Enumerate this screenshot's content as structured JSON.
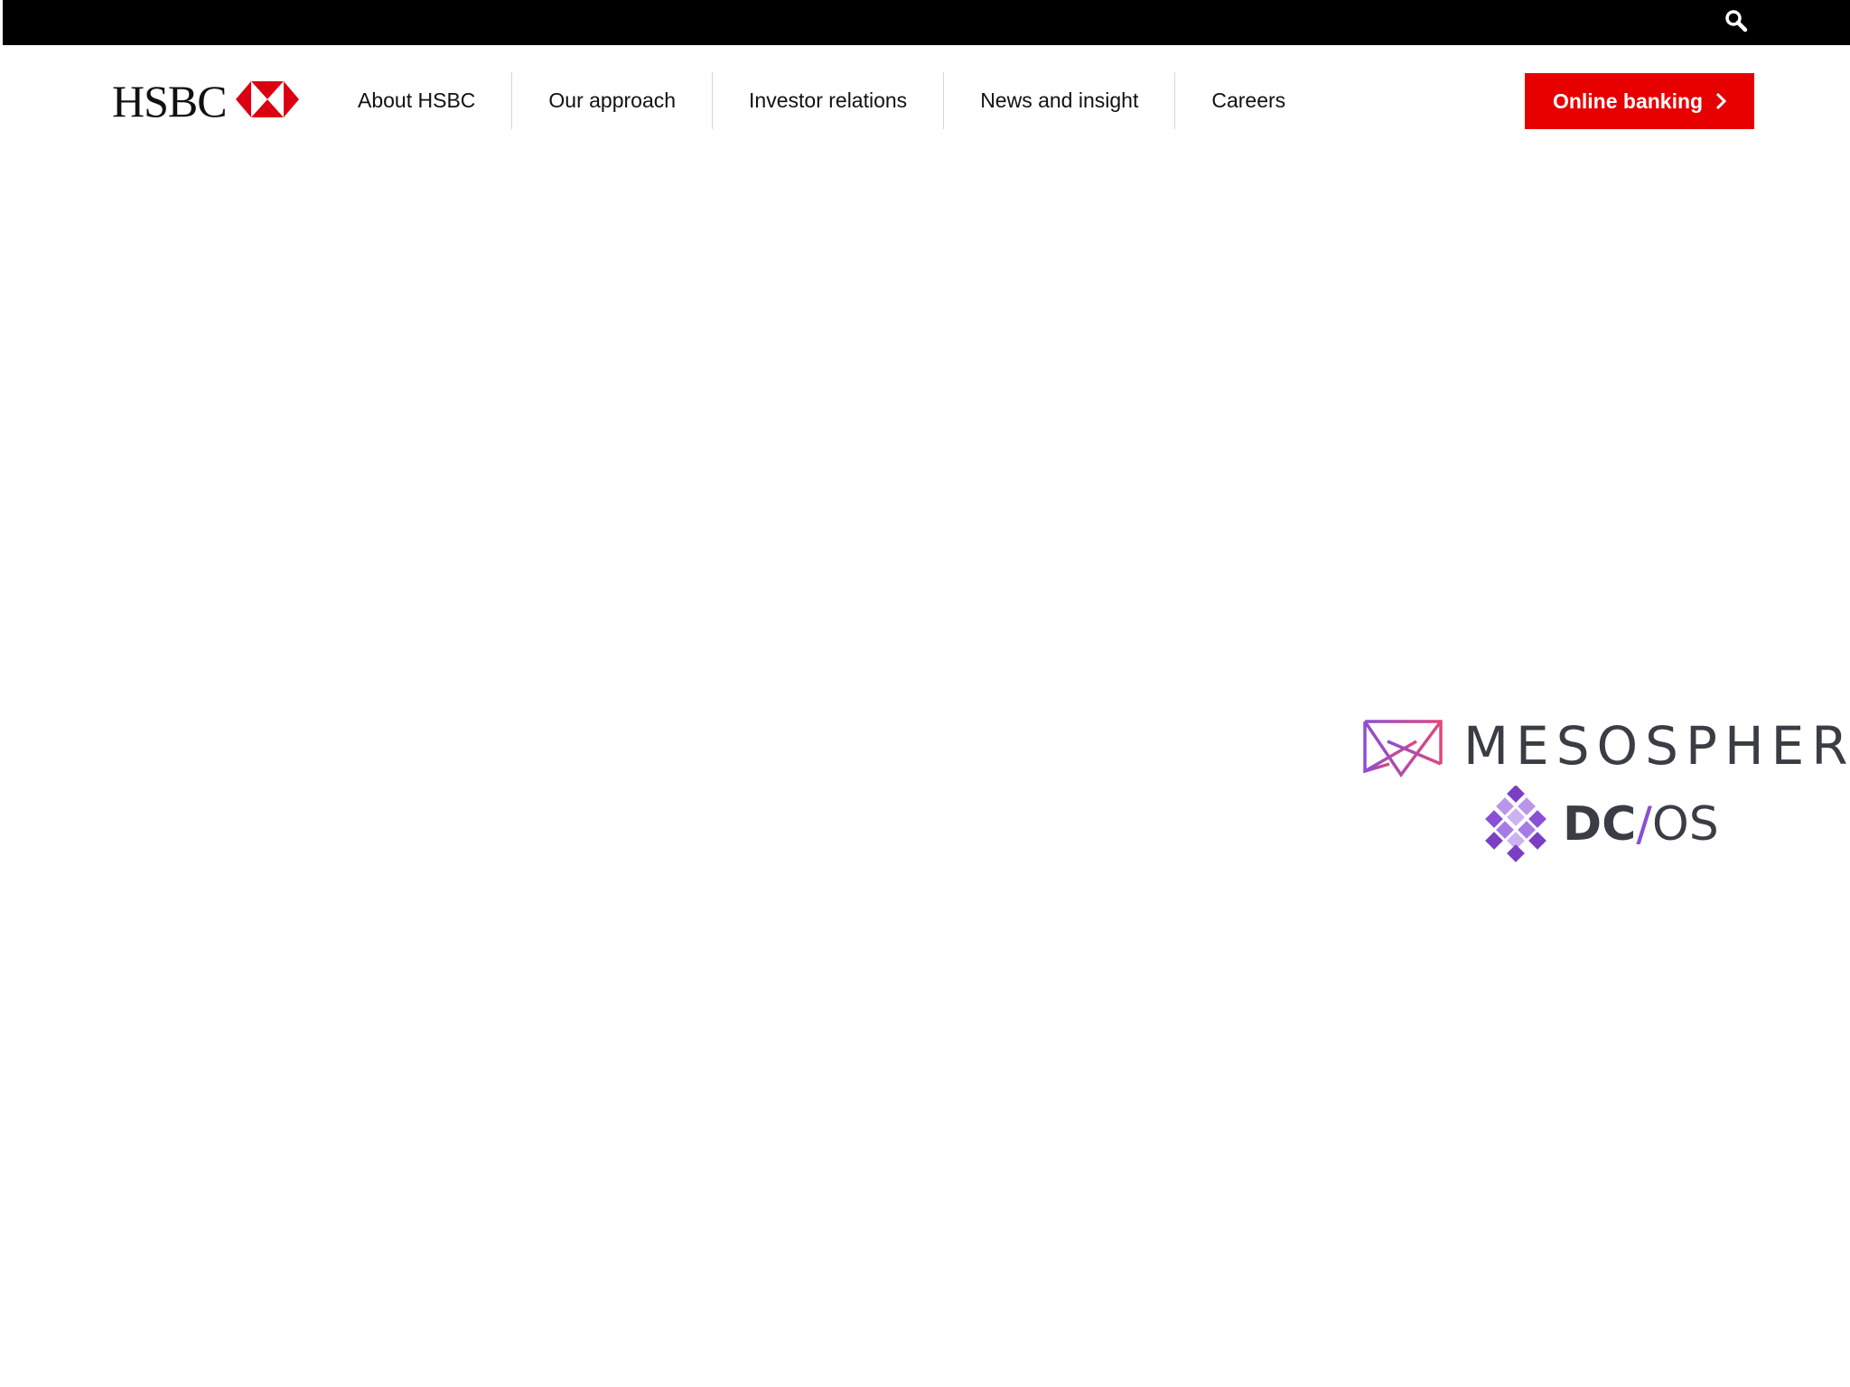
{
  "topbar": {
    "search_icon": "search-icon"
  },
  "header": {
    "logo_text": "HSBC",
    "logo_icon": "hsbc-hexagon-icon",
    "nav": [
      {
        "label": "About HSBC"
      },
      {
        "label": "Our approach"
      },
      {
        "label": "Investor relations"
      },
      {
        "label": "News and insight"
      },
      {
        "label": "Careers"
      }
    ],
    "online_banking_label": "Online banking",
    "online_banking_icon": "chevron-right-icon"
  },
  "main": {
    "mesosphere_logo_text": "MESOSPHERE",
    "dcos_logo_dc": "DC",
    "dcos_logo_slash": "/",
    "dcos_logo_os": "OS"
  },
  "colors": {
    "topbar": "#000000",
    "brand_red": "#e60000",
    "mesosphere_pink": "#e0487a",
    "mesosphere_purple": "#8a4fd4",
    "text": "#111111"
  }
}
